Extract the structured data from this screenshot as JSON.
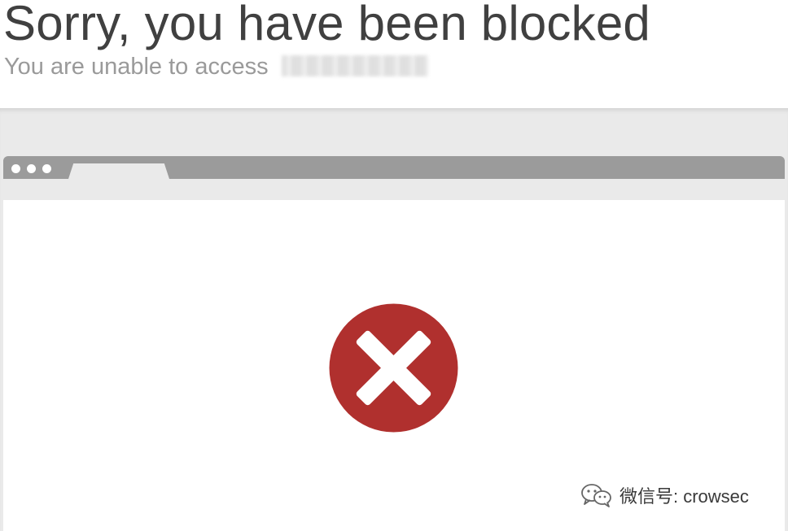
{
  "header": {
    "title": "Sorry, you have been blocked",
    "subtitle": "You are unable to access"
  },
  "browser_illustration": {
    "content_icon": "error-x-icon",
    "error_color": "#b0302e"
  },
  "watermark": {
    "icon": "wechat-icon",
    "text": "微信号: crowsec"
  }
}
